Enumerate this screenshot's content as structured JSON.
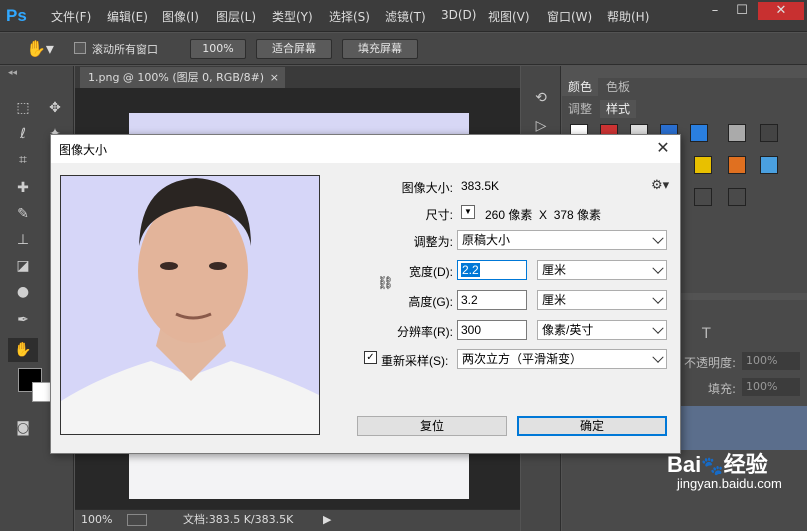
{
  "app": {
    "logo": "Ps"
  },
  "menu": [
    "文件(F)",
    "编辑(E)",
    "图像(I)",
    "图层(L)",
    "类型(Y)",
    "选择(S)",
    "滤镜(T)",
    "3D(D)",
    "视图(V)",
    "窗口(W)",
    "帮助(H)"
  ],
  "options": {
    "scroll_all": "滚动所有窗口",
    "zoom100": "100%",
    "fit_screen": "适合屏幕",
    "fill_screen": "填充屏幕"
  },
  "document": {
    "tab_title": "1.png @ 100% (图层 0, RGB/8#)",
    "tab_close": "×"
  },
  "status": {
    "zoom": "100%",
    "doc_info": "文档:383.5 K/383.5K"
  },
  "panels": {
    "tab_color": "颜色",
    "tab_swatches": "色板",
    "tab_adjust": "调整",
    "tab_styles": "样式",
    "opacity_label": "不透明度:",
    "opacity_value": "100%",
    "fill_label": "填充:",
    "fill_value": "100%"
  },
  "dialog": {
    "title": "图像大小",
    "image_size_label": "图像大小:",
    "image_size_value": "383.5K",
    "dimensions_label": "尺寸:",
    "dimensions_value": "260 像素  X  378 像素",
    "fit_to_label": "调整为:",
    "fit_to_value": "原稿大小",
    "width_label": "宽度(D):",
    "width_value": "2.2",
    "width_unit": "厘米",
    "height_label": "高度(G):",
    "height_value": "3.2",
    "height_unit": "厘米",
    "resolution_label": "分辨率(R):",
    "resolution_value": "300",
    "resolution_unit": "像素/英寸",
    "resample_label": "重新采样(S):",
    "resample_value": "两次立方（平滑渐变）",
    "reset_button": "复位",
    "ok_button": "确定"
  },
  "watermark": {
    "text": "jingyan.baidu.com"
  }
}
